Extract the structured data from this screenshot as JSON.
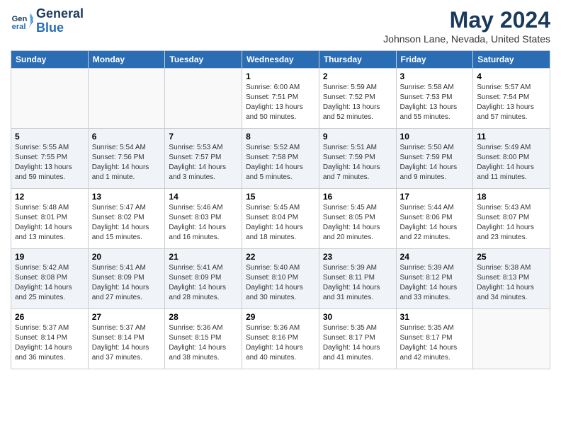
{
  "header": {
    "logo_line1": "General",
    "logo_line2": "Blue",
    "month": "May 2024",
    "location": "Johnson Lane, Nevada, United States"
  },
  "days_of_week": [
    "Sunday",
    "Monday",
    "Tuesday",
    "Wednesday",
    "Thursday",
    "Friday",
    "Saturday"
  ],
  "weeks": [
    {
      "shaded": false,
      "days": [
        {
          "num": "",
          "info": ""
        },
        {
          "num": "",
          "info": ""
        },
        {
          "num": "",
          "info": ""
        },
        {
          "num": "1",
          "info": "Sunrise: 6:00 AM\nSunset: 7:51 PM\nDaylight: 13 hours\nand 50 minutes."
        },
        {
          "num": "2",
          "info": "Sunrise: 5:59 AM\nSunset: 7:52 PM\nDaylight: 13 hours\nand 52 minutes."
        },
        {
          "num": "3",
          "info": "Sunrise: 5:58 AM\nSunset: 7:53 PM\nDaylight: 13 hours\nand 55 minutes."
        },
        {
          "num": "4",
          "info": "Sunrise: 5:57 AM\nSunset: 7:54 PM\nDaylight: 13 hours\nand 57 minutes."
        }
      ]
    },
    {
      "shaded": true,
      "days": [
        {
          "num": "5",
          "info": "Sunrise: 5:55 AM\nSunset: 7:55 PM\nDaylight: 13 hours\nand 59 minutes."
        },
        {
          "num": "6",
          "info": "Sunrise: 5:54 AM\nSunset: 7:56 PM\nDaylight: 14 hours\nand 1 minute."
        },
        {
          "num": "7",
          "info": "Sunrise: 5:53 AM\nSunset: 7:57 PM\nDaylight: 14 hours\nand 3 minutes."
        },
        {
          "num": "8",
          "info": "Sunrise: 5:52 AM\nSunset: 7:58 PM\nDaylight: 14 hours\nand 5 minutes."
        },
        {
          "num": "9",
          "info": "Sunrise: 5:51 AM\nSunset: 7:59 PM\nDaylight: 14 hours\nand 7 minutes."
        },
        {
          "num": "10",
          "info": "Sunrise: 5:50 AM\nSunset: 7:59 PM\nDaylight: 14 hours\nand 9 minutes."
        },
        {
          "num": "11",
          "info": "Sunrise: 5:49 AM\nSunset: 8:00 PM\nDaylight: 14 hours\nand 11 minutes."
        }
      ]
    },
    {
      "shaded": false,
      "days": [
        {
          "num": "12",
          "info": "Sunrise: 5:48 AM\nSunset: 8:01 PM\nDaylight: 14 hours\nand 13 minutes."
        },
        {
          "num": "13",
          "info": "Sunrise: 5:47 AM\nSunset: 8:02 PM\nDaylight: 14 hours\nand 15 minutes."
        },
        {
          "num": "14",
          "info": "Sunrise: 5:46 AM\nSunset: 8:03 PM\nDaylight: 14 hours\nand 16 minutes."
        },
        {
          "num": "15",
          "info": "Sunrise: 5:45 AM\nSunset: 8:04 PM\nDaylight: 14 hours\nand 18 minutes."
        },
        {
          "num": "16",
          "info": "Sunrise: 5:45 AM\nSunset: 8:05 PM\nDaylight: 14 hours\nand 20 minutes."
        },
        {
          "num": "17",
          "info": "Sunrise: 5:44 AM\nSunset: 8:06 PM\nDaylight: 14 hours\nand 22 minutes."
        },
        {
          "num": "18",
          "info": "Sunrise: 5:43 AM\nSunset: 8:07 PM\nDaylight: 14 hours\nand 23 minutes."
        }
      ]
    },
    {
      "shaded": true,
      "days": [
        {
          "num": "19",
          "info": "Sunrise: 5:42 AM\nSunset: 8:08 PM\nDaylight: 14 hours\nand 25 minutes."
        },
        {
          "num": "20",
          "info": "Sunrise: 5:41 AM\nSunset: 8:09 PM\nDaylight: 14 hours\nand 27 minutes."
        },
        {
          "num": "21",
          "info": "Sunrise: 5:41 AM\nSunset: 8:09 PM\nDaylight: 14 hours\nand 28 minutes."
        },
        {
          "num": "22",
          "info": "Sunrise: 5:40 AM\nSunset: 8:10 PM\nDaylight: 14 hours\nand 30 minutes."
        },
        {
          "num": "23",
          "info": "Sunrise: 5:39 AM\nSunset: 8:11 PM\nDaylight: 14 hours\nand 31 minutes."
        },
        {
          "num": "24",
          "info": "Sunrise: 5:39 AM\nSunset: 8:12 PM\nDaylight: 14 hours\nand 33 minutes."
        },
        {
          "num": "25",
          "info": "Sunrise: 5:38 AM\nSunset: 8:13 PM\nDaylight: 14 hours\nand 34 minutes."
        }
      ]
    },
    {
      "shaded": false,
      "days": [
        {
          "num": "26",
          "info": "Sunrise: 5:37 AM\nSunset: 8:14 PM\nDaylight: 14 hours\nand 36 minutes."
        },
        {
          "num": "27",
          "info": "Sunrise: 5:37 AM\nSunset: 8:14 PM\nDaylight: 14 hours\nand 37 minutes."
        },
        {
          "num": "28",
          "info": "Sunrise: 5:36 AM\nSunset: 8:15 PM\nDaylight: 14 hours\nand 38 minutes."
        },
        {
          "num": "29",
          "info": "Sunrise: 5:36 AM\nSunset: 8:16 PM\nDaylight: 14 hours\nand 40 minutes."
        },
        {
          "num": "30",
          "info": "Sunrise: 5:35 AM\nSunset: 8:17 PM\nDaylight: 14 hours\nand 41 minutes."
        },
        {
          "num": "31",
          "info": "Sunrise: 5:35 AM\nSunset: 8:17 PM\nDaylight: 14 hours\nand 42 minutes."
        },
        {
          "num": "",
          "info": ""
        }
      ]
    }
  ]
}
